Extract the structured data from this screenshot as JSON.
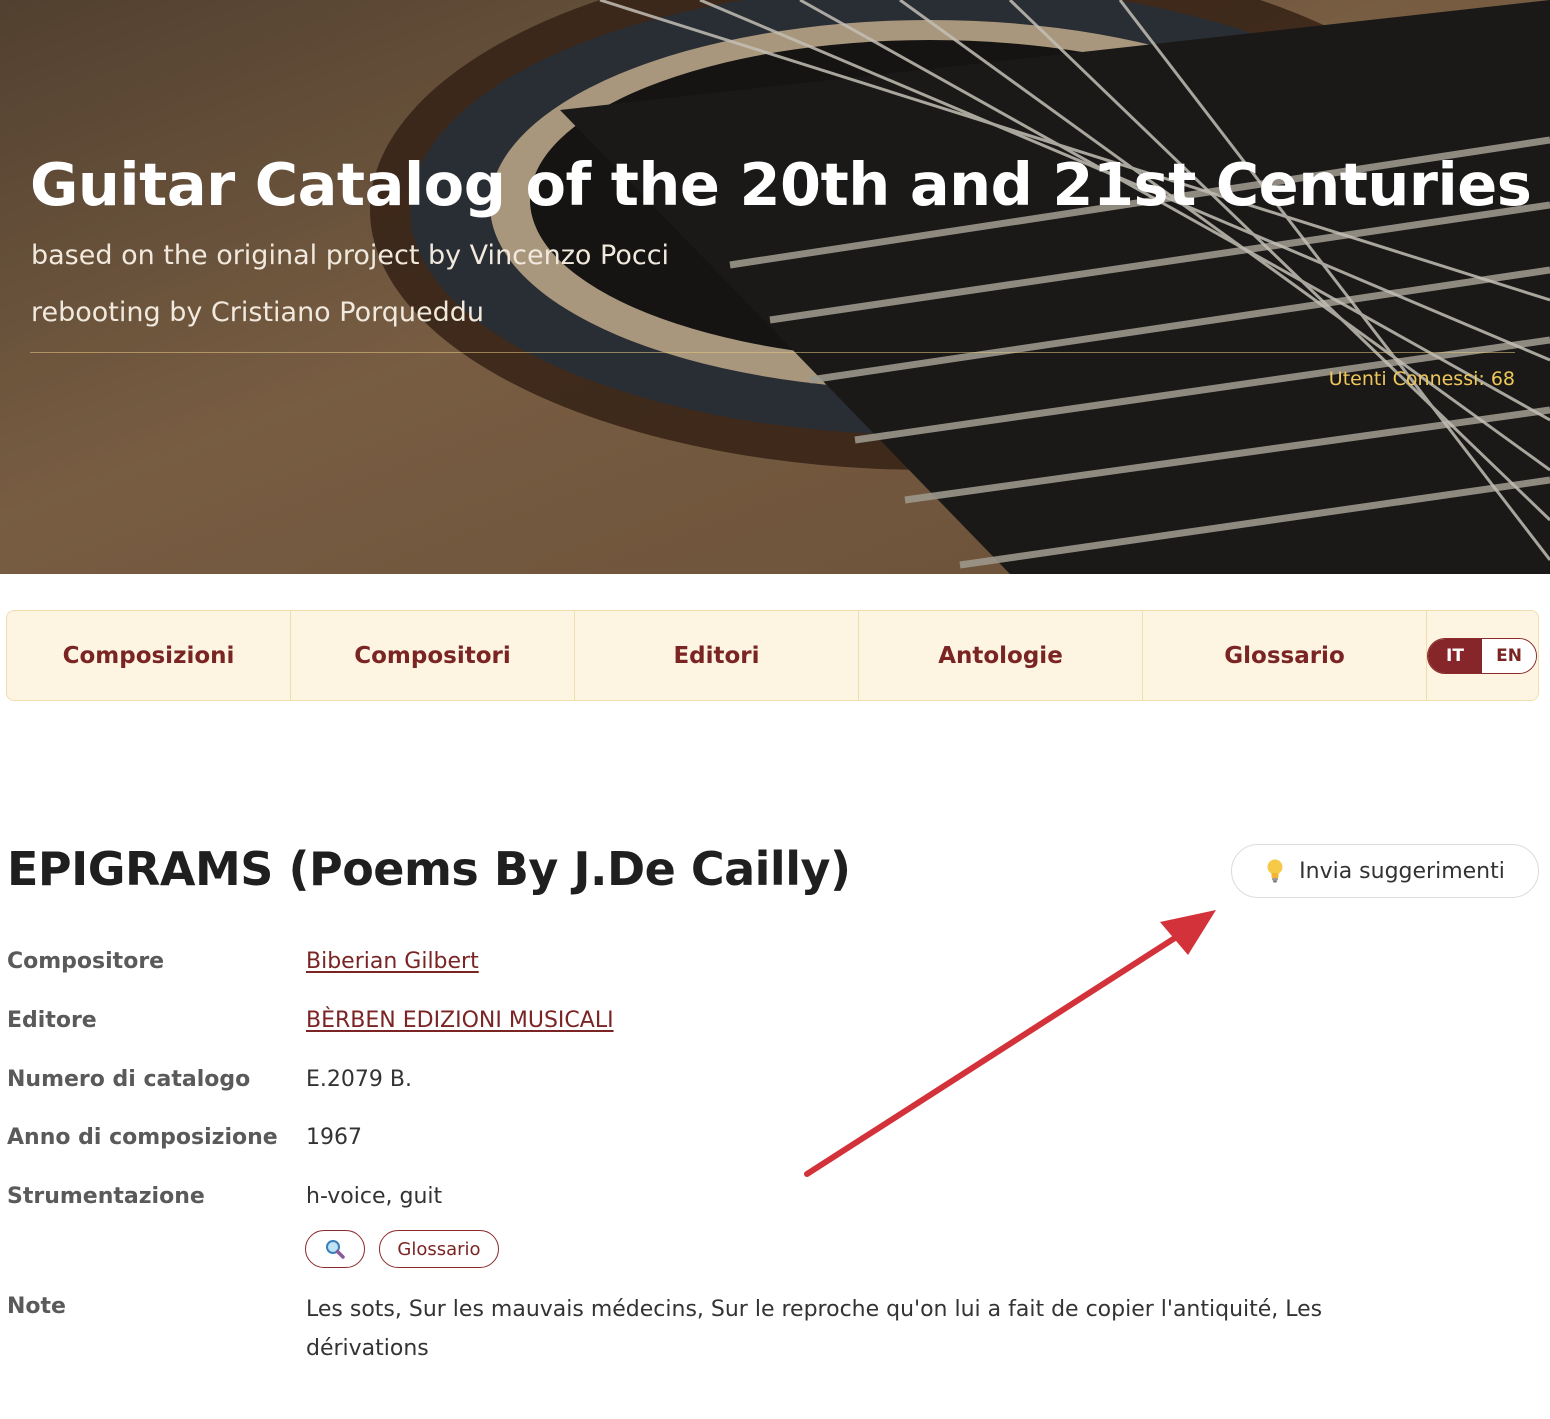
{
  "header": {
    "title": "Guitar Catalog of the 20th and 21st Centuries",
    "subtitle_1": "based on the original project by Vincenzo Pocci",
    "subtitle_2": "rebooting by Cristiano Porqueddu",
    "online_users": "Utenti Connessi: 68"
  },
  "nav": {
    "items": [
      {
        "label": "Composizioni"
      },
      {
        "label": "Compositori"
      },
      {
        "label": "Editori"
      },
      {
        "label": "Antologie"
      },
      {
        "label": "Glossario"
      }
    ],
    "lang": {
      "it": "IT",
      "en": "EN",
      "active": "IT"
    }
  },
  "composition": {
    "title": "EPIGRAMS (Poems By J.De Cailly)",
    "suggest_button": "Invia suggerimenti",
    "fields": {
      "composer": {
        "label": "Compositore",
        "value": "Biberian Gilbert"
      },
      "publisher": {
        "label": "Editore",
        "value": "BÈRBEN EDIZIONI MUSICALI"
      },
      "catalog_number": {
        "label": "Numero di catalogo",
        "value": "E.2079 B."
      },
      "year": {
        "label": "Anno di composizione",
        "value": "1967"
      },
      "instrumentation": {
        "label": "Strumentazione",
        "value": "h-voice, guit"
      },
      "note": {
        "label": "Note",
        "value": "Les sots, Sur les mauvais médecins, Sur le reproche qu'on lui a fait de copier l'antiquité, Les dérivations"
      }
    },
    "glossary_button": "Glossario",
    "search_icon": "magnifier-icon"
  },
  "colors": {
    "accent": "#7a2424",
    "nav_bg": "#fdf5e1",
    "annotation_arrow": "#d3323a",
    "online_users": "#f0c75a"
  }
}
